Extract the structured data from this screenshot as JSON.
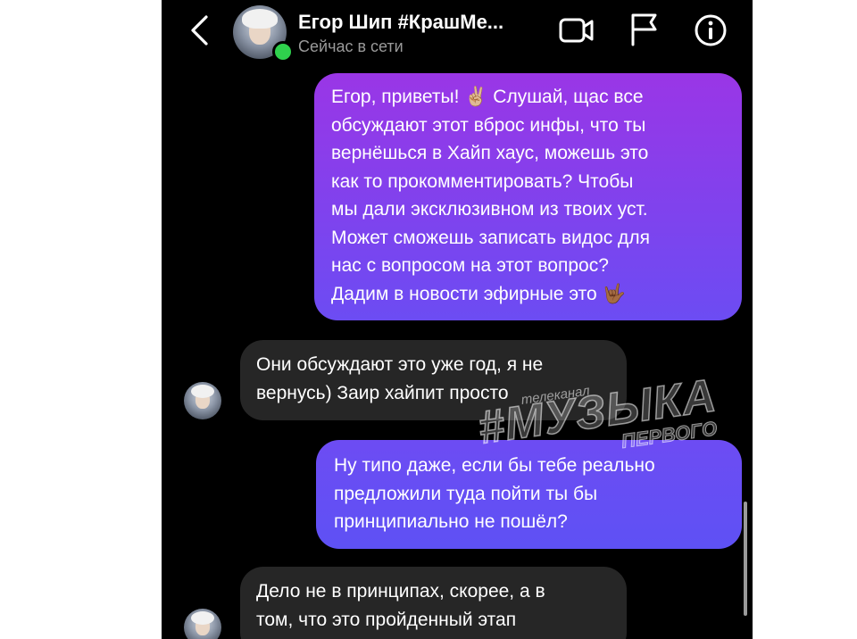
{
  "header": {
    "contact_name": "Егор Шип #КрашМе...",
    "status": "Сейчас в сети",
    "icons": [
      "back-icon",
      "video-call-icon",
      "flag-icon",
      "info-icon"
    ]
  },
  "messages": [
    {
      "direction": "outgoing",
      "lines": [
        "Егор, приветы! ✌🏼 Слушай, щас все",
        "обсуждают этот вброс инфы, что ты",
        "вернёшься в Хайп хаус, можешь это",
        "как то прокомментировать? Чтобы",
        "мы дали эксклюзивном из твоих уст.",
        "Может сможешь записать видос для",
        "нас с вопросом на этот вопрос?",
        "Дадим в новости эфирные это 🤟🏾"
      ]
    },
    {
      "direction": "incoming",
      "lines": [
        "Они обсуждают это уже год, я не",
        "вернусь) Заир хайпит просто"
      ]
    },
    {
      "direction": "outgoing",
      "lines": [
        "Ну типо даже, если бы тебе реально",
        "предложили туда пойти ты бы",
        "принципиально не пошёл?"
      ]
    },
    {
      "direction": "incoming",
      "lines": [
        "Дело не в принципах, скорее, а в",
        "том, что это пройденный этап"
      ]
    }
  ],
  "watermark": {
    "top": "телеканал",
    "main": "#МУЗЫКА",
    "bottom": "ПЕРВОГО"
  },
  "colors": {
    "background": "#000000",
    "outgoing_bubble_top": "#9a36e6",
    "outgoing_bubble_bottom": "#6c4cf3",
    "incoming_bubble": "#262626",
    "online_indicator": "#2fd14d"
  }
}
